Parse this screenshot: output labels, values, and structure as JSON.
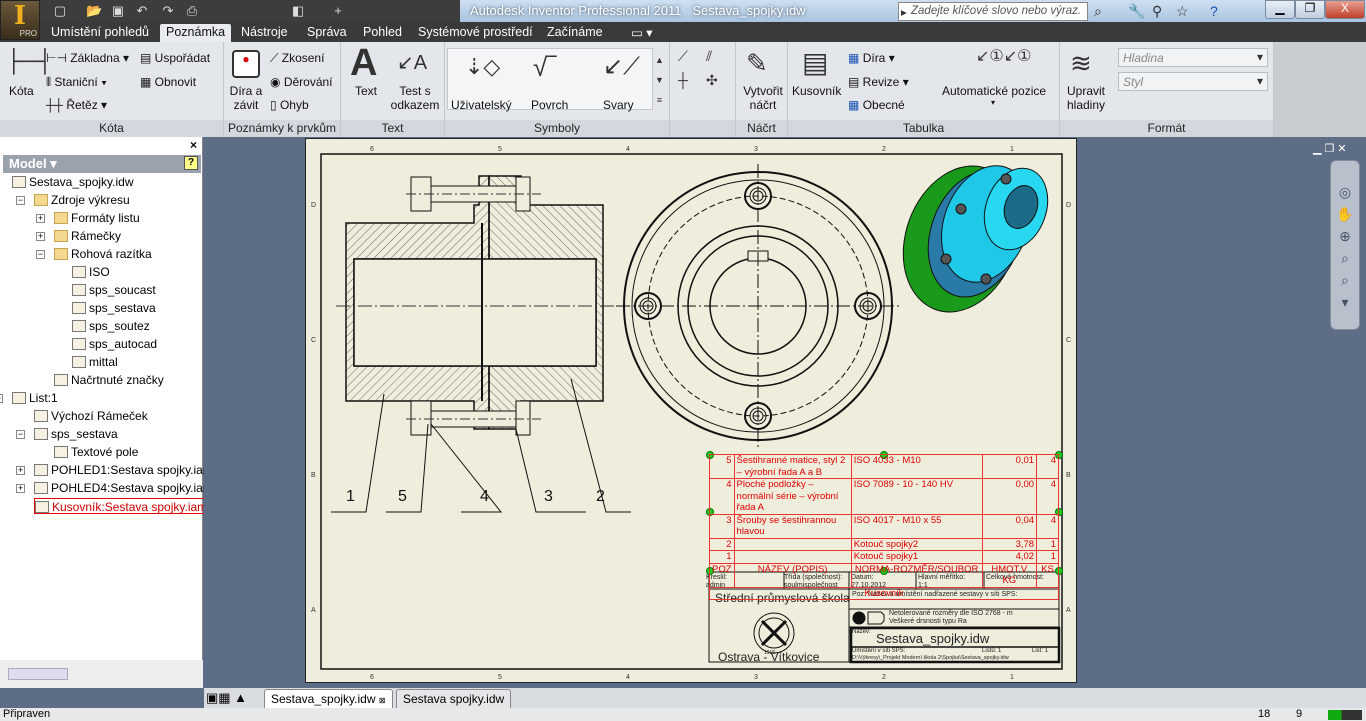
{
  "app": {
    "title": "Autodesk Inventor Professional 2011",
    "document": "Sestava_spojky.idw",
    "logo_letter": "I",
    "edition": "PRO",
    "search_placeholder": "Zadejte klíčové slovo nebo výraz."
  },
  "tabs": [
    "Umístění pohledů",
    "Poznámka",
    "Nástroje",
    "Správa",
    "Pohled",
    "Systémové prostředí",
    "Začínáme"
  ],
  "active_tab": "Poznámka",
  "ribbon": {
    "kota": {
      "label": "Kóta",
      "big": "Kóta",
      "items": [
        "Základna",
        "Staniční",
        "Řetěz",
        "Uspořádat",
        "Obnovit"
      ]
    },
    "poznamky": {
      "label": "Poznámky k prvkům",
      "big": "Díra a závit",
      "items": [
        "Zkosení",
        "Děrování",
        "Ohyb"
      ]
    },
    "text": {
      "label": "Text",
      "items": [
        "Text",
        "Test s odkazem"
      ]
    },
    "symboly": {
      "label": "Symboly",
      "items": [
        "Uživatelský",
        "Povrch",
        "Svary"
      ]
    },
    "nacrt": {
      "label": "Náčrt",
      "big": "Vytvořit náčrt"
    },
    "tabulka": {
      "label": "Tabulka",
      "big": "Kusovník",
      "items": [
        "Díra",
        "Revize",
        "Obecné"
      ],
      "auto": "Automatické pozice"
    },
    "format": {
      "label": "Formát",
      "big": "Upravit hladiny",
      "layer_placeholder": "Hladina",
      "style_placeholder": "Styl"
    }
  },
  "browser": {
    "title": "Model",
    "items": [
      {
        "label": "Sestava_spojky.idw"
      },
      {
        "label": "Zdroje výkresu"
      },
      {
        "label": "Formáty listu"
      },
      {
        "label": "Rámečky"
      },
      {
        "label": "Rohová razítka"
      },
      {
        "label": "ISO"
      },
      {
        "label": "sps_soucast"
      },
      {
        "label": "sps_sestava"
      },
      {
        "label": "sps_soutez"
      },
      {
        "label": "sps_autocad"
      },
      {
        "label": "mittal"
      },
      {
        "label": "Načrtnuté značky"
      },
      {
        "label": "List:1"
      },
      {
        "label": "Výchozí Rámeček"
      },
      {
        "label": "sps_sestava"
      },
      {
        "label": "Textové pole"
      },
      {
        "label": "POHLED1:Sestava spojky.iam"
      },
      {
        "label": "POHLED4:Sestava spojky.iam"
      },
      {
        "label": "Kusovník:Sestava spojky.iam"
      }
    ]
  },
  "drawing": {
    "zone_columns": [
      "6",
      "5",
      "4",
      "3",
      "2",
      "1"
    ],
    "zone_rows": [
      "D",
      "C",
      "B",
      "A"
    ],
    "balloons": [
      "1",
      "5",
      "4",
      "3",
      "2"
    ],
    "bom": {
      "rows": [
        {
          "poz": "5",
          "nazev": "Šestihranné matice, styl 2 – výrobní řada A a B",
          "norma": "ISO 4033 - M10",
          "hmot": "0,01",
          "ks": "4"
        },
        {
          "poz": "4",
          "nazev": "Ploché podložky – normální série – výrobní řada A",
          "norma": "ISO 7089 - 10 - 140 HV",
          "hmot": "0,00",
          "ks": "4"
        },
        {
          "poz": "3",
          "nazev": "Šrouby se šestihrannou hlavou",
          "norma": "ISO 4017 - M10 x 55",
          "hmot": "0,04",
          "ks": "4"
        },
        {
          "poz": "2",
          "nazev": "",
          "norma": "Kotouč spojky2",
          "hmot": "3,78",
          "ks": "1"
        },
        {
          "poz": "1",
          "nazev": "",
          "norma": "Kotouč spojky1",
          "hmot": "4,02",
          "ks": "1"
        }
      ],
      "headers": {
        "poz": "POZ",
        "nazev": "NÁZEV (POPIS)",
        "norma": "NORMA-ROZMĚR/SOUBOR",
        "hmot": "HMOT.V KG",
        "ks": "KS"
      },
      "title": "Kusovník"
    },
    "titleblock": {
      "kreslil_label": "Kreslil:",
      "kreslil": "admin",
      "trida_label": "Třída (společnost):",
      "trida": "soulmispolečnost",
      "datum_label": "Datum:",
      "datum": "27.10.2012",
      "meritko_label": "Hlavní měřítko:",
      "meritko": "1:1",
      "hmotnost_label": "Celková hmotnost:",
      "school": "Střední průmyslová škola",
      "city": "Ostrava - Vítkovice",
      "emblem_year": "1915",
      "poz_label": "Poz:",
      "nadrazena": "Název a umístění nadřazené sestavy v síti SPS:",
      "tolerance": "Netolerované rozměry dle ISO 2768 - m",
      "drsnost": "Veškeré drsnosti typu Ra",
      "nazev_label": "Název:",
      "nazev": "Sestava_spojky.idw",
      "umisteni_label": "Umístění v síti SPS:",
      "listu": "Listů: 1",
      "list": "List: 1",
      "path": "D:\\Výkresy\\_Projekt Moderní škola 2\\Spojka\\Sestava_spojky.idw"
    }
  },
  "document_tabs": [
    "Sestava_spojky.idw",
    "Sestava spojky.idw"
  ],
  "status": {
    "text": "Připraven",
    "n1": "18",
    "n2": "9"
  },
  "colors": {
    "bom_red": "#dd0000",
    "hub_cyan": "#20c8e8",
    "flange_green": "#1a9a1a",
    "canvas": "#5d6d85",
    "sheet": "#efeddc"
  }
}
